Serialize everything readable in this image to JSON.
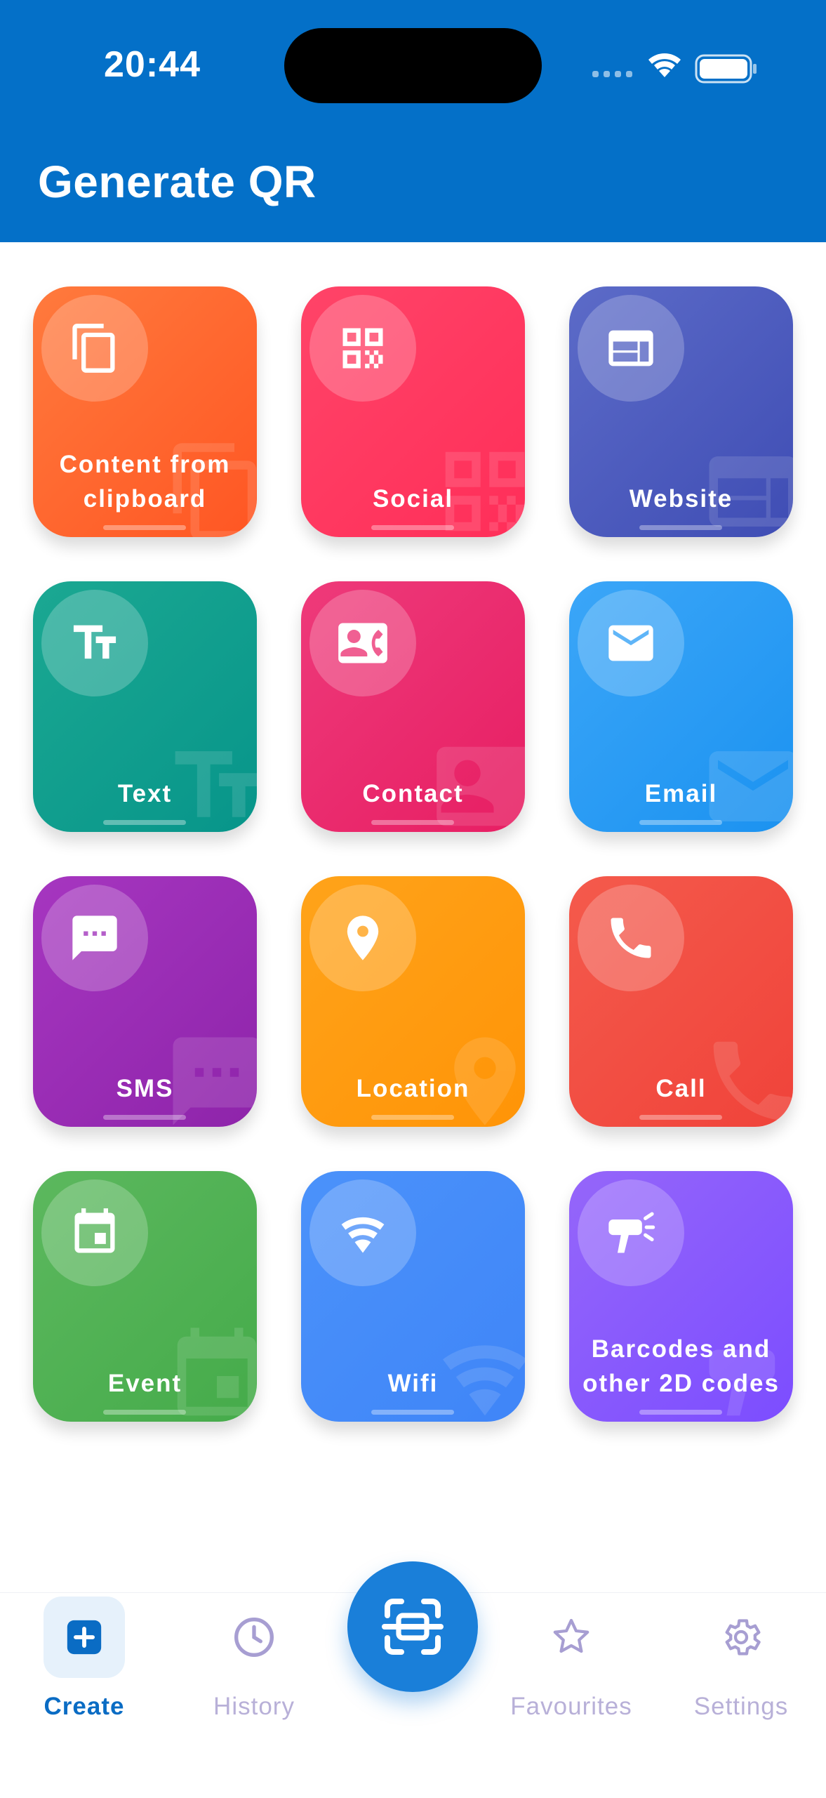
{
  "status_bar": {
    "time": "20:44"
  },
  "header": {
    "title": "Generate QR"
  },
  "colors": {
    "header_bg": "#0470C8",
    "accent": "#0A6CC4",
    "inactive": "#B8B0D8"
  },
  "tiles": [
    {
      "label": "Content from\nclipboard",
      "icon": "clipboard-copy-icon",
      "gradient": [
        "#FF7A3D",
        "#FF5623"
      ]
    },
    {
      "label": "Social",
      "icon": "qr-code-icon",
      "gradient": [
        "#FF4468",
        "#FF2E59"
      ]
    },
    {
      "label": "Website",
      "icon": "web-page-icon",
      "gradient": [
        "#5C6BC8",
        "#3F4DB4"
      ]
    },
    {
      "label": "Text",
      "icon": "text-format-icon",
      "gradient": [
        "#1BA892",
        "#07958A"
      ]
    },
    {
      "label": "Contact",
      "icon": "contact-card-icon",
      "gradient": [
        "#EE3A7A",
        "#E71E63"
      ]
    },
    {
      "label": "Email",
      "icon": "email-icon",
      "gradient": [
        "#3BA6F8",
        "#1B92F0"
      ]
    },
    {
      "label": "SMS",
      "icon": "message-icon",
      "gradient": [
        "#A636C0",
        "#8E24AA"
      ]
    },
    {
      "label": "Location",
      "icon": "location-pin-icon",
      "gradient": [
        "#FFA31A",
        "#FF9407"
      ]
    },
    {
      "label": "Call",
      "icon": "phone-icon",
      "gradient": [
        "#F45A4C",
        "#F0433A"
      ]
    },
    {
      "label": "Event",
      "icon": "calendar-icon",
      "gradient": [
        "#5CB85E",
        "#45AB4A"
      ]
    },
    {
      "label": "Wifi",
      "icon": "wifi-icon",
      "gradient": [
        "#4B92FA",
        "#3F85F8"
      ]
    },
    {
      "label": "Barcodes and\nother 2D codes",
      "icon": "barcode-scanner-icon",
      "gradient": [
        "#9566FA",
        "#7C4DFF"
      ]
    }
  ],
  "nav": {
    "create": "Create",
    "history": "History",
    "favourites": "Favourites",
    "settings": "Settings"
  }
}
